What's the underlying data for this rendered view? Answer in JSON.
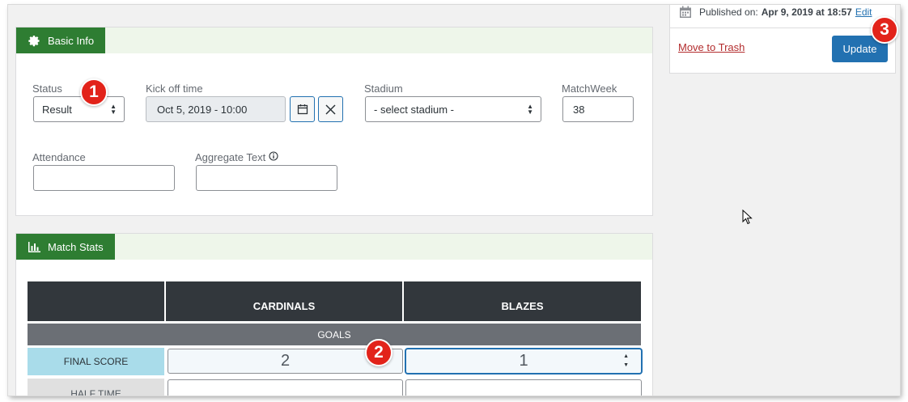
{
  "basic_info": {
    "tab_label": "Basic Info",
    "status": {
      "label": "Status",
      "value": "Result"
    },
    "kickoff": {
      "label": "Kick off time",
      "value": "Oct 5, 2019 - 10:00"
    },
    "stadium": {
      "label": "Stadium",
      "value": "- select stadium -"
    },
    "matchweek": {
      "label": "MatchWeek",
      "value": "38"
    },
    "attendance": {
      "label": "Attendance",
      "value": ""
    },
    "aggregate_text": {
      "label": "Aggregate Text",
      "value": ""
    }
  },
  "match_stats": {
    "tab_label": "Match Stats",
    "columns": [
      "",
      "CARDINALS",
      "BLAZES"
    ],
    "section": "GOALS",
    "rows": [
      {
        "label": "FINAL SCORE",
        "values": [
          "2",
          "1"
        ]
      },
      {
        "label": "HALF TIME",
        "values": [
          "",
          ""
        ]
      }
    ]
  },
  "publish_box": {
    "published_prefix": "Published on:",
    "published_date": "Apr 9, 2019 at 18:57",
    "edit_link": "Edit",
    "trash_link": "Move to Trash",
    "update_label": "Update"
  },
  "markers": [
    "1",
    "2",
    "3"
  ],
  "colors": {
    "tab_green": "#2e7d32",
    "header_tint": "#eef6ea",
    "table_header": "#32373c",
    "goals_row": "#6b6f75",
    "label_cell": "#a9dcea",
    "primary_blue": "#2271b1",
    "marker_red": "#e2231a",
    "trash_red": "#b32d2e"
  }
}
